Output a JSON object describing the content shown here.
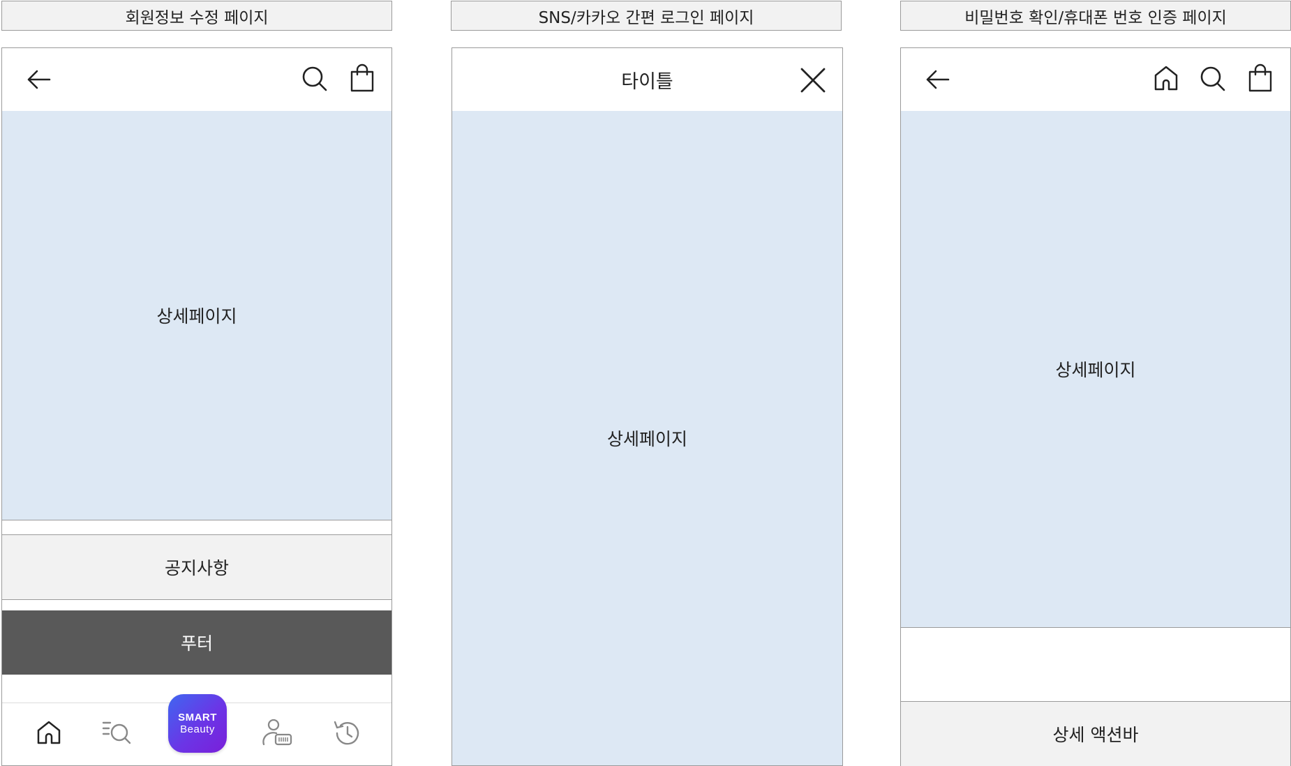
{
  "labels": {
    "left": "회원정보 수정 페이지",
    "middle": "SNS/카카오 간편 로그인 페이지",
    "right": "비밀번호 확인/휴대폰 번호 인증 페이지"
  },
  "left_screen": {
    "icons": [
      "back-arrow-icon",
      "search-icon",
      "shopping-bag-icon"
    ],
    "content_label": "상세페이지",
    "notice_label": "공지사항",
    "footer_label": "푸터",
    "tabbar": {
      "items": [
        "home-icon",
        "search-list-icon",
        "smart-beauty-button",
        "member-barcode-icon",
        "history-icon"
      ],
      "smart_button": {
        "line1": "SMART",
        "line2": "Beauty"
      }
    }
  },
  "middle_screen": {
    "title": "타이틀",
    "icons": [
      "close-icon"
    ],
    "content_label": "상세페이지"
  },
  "right_screen": {
    "icons": [
      "back-arrow-icon",
      "home-icon",
      "search-icon",
      "shopping-bag-icon"
    ],
    "content_label": "상세페이지",
    "action_bar_label": "상세 액션바"
  },
  "colors": {
    "content_bg": "#dde8f4",
    "notice_bg": "#f2f2f2",
    "footer_bg": "#595959",
    "smart_gradient_start": "#3f67f0",
    "smart_gradient_end": "#7a1fd9"
  }
}
